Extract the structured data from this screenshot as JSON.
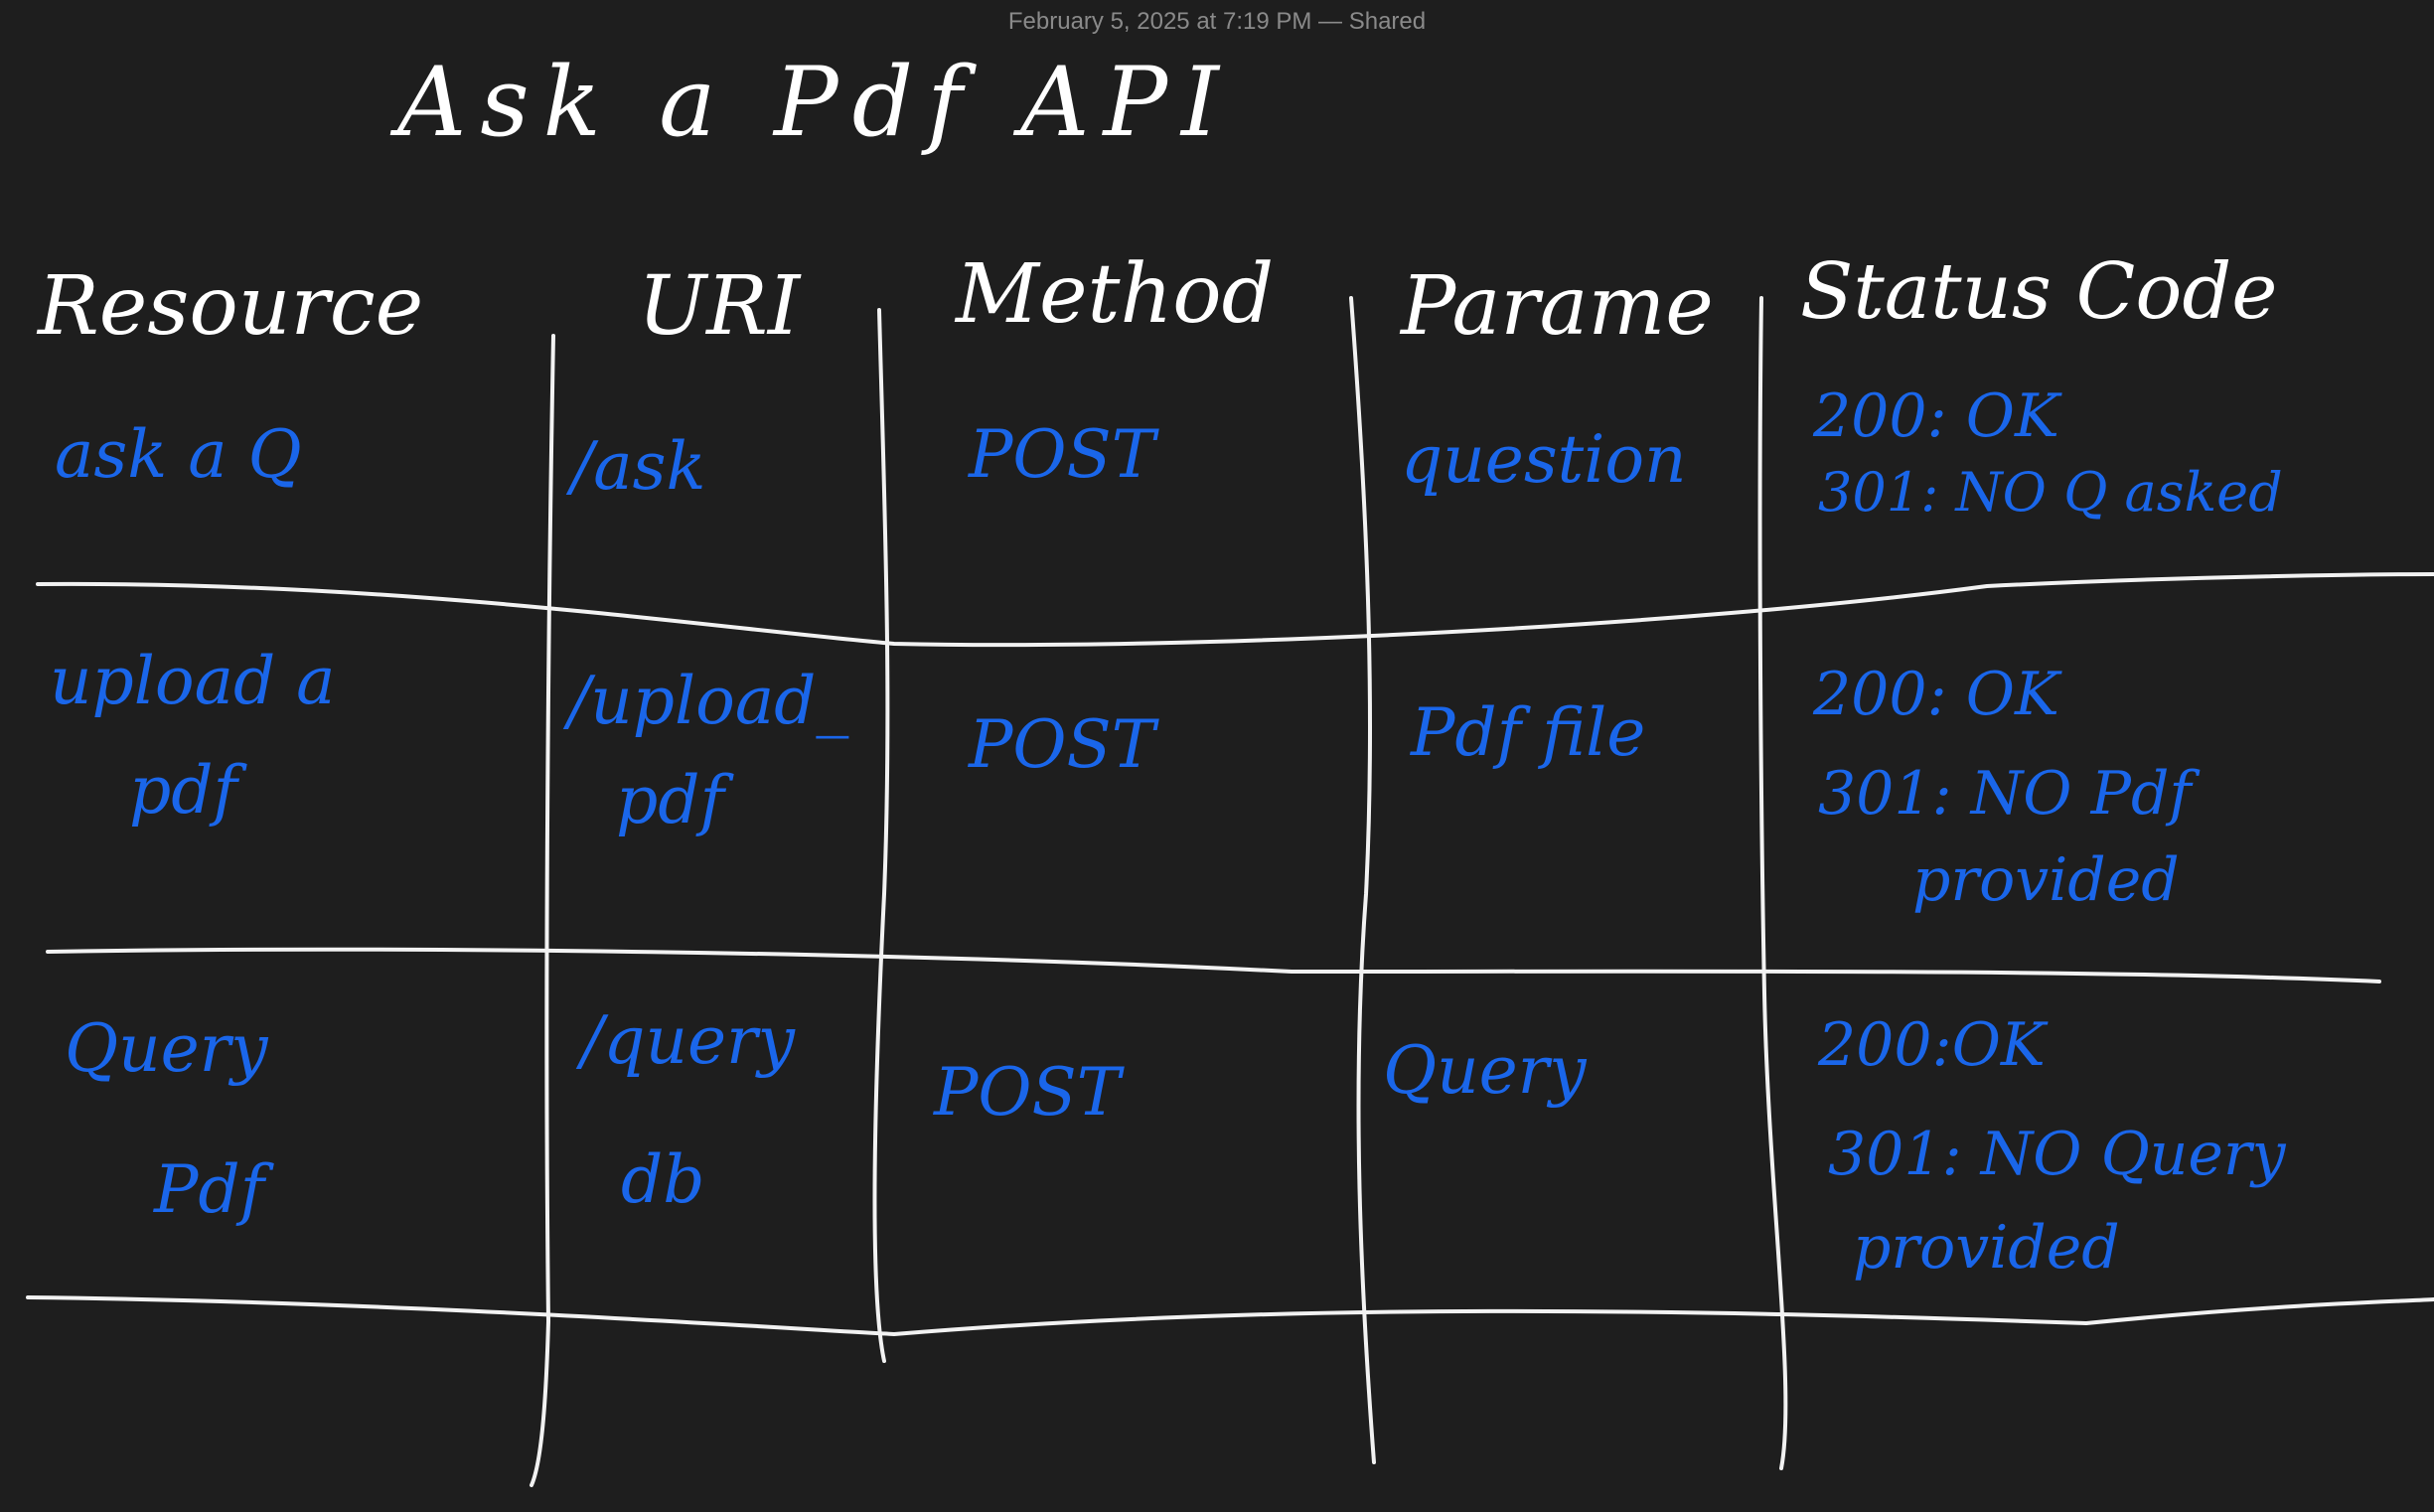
{
  "note": {
    "timestamp": "February 5, 2025 at 7:19 PM — Shared",
    "title": "Ask a Pdf API",
    "ink_colors": {
      "header": "#ffffff",
      "content": "#1a66ea",
      "background": "#1e1e1e"
    }
  },
  "table": {
    "headers": [
      "Resource",
      "URI",
      "Method",
      "Parame",
      "Status Code"
    ],
    "rows": [
      {
        "resource": [
          "ask a Q"
        ],
        "uri": [
          "/ask"
        ],
        "method": [
          "POST"
        ],
        "param": [
          "question"
        ],
        "status": [
          "200: OK",
          "301: NO Q asked"
        ]
      },
      {
        "resource": [
          "upload a",
          "pdf"
        ],
        "uri": [
          "/upload_",
          "pdf"
        ],
        "method": [
          "POST"
        ],
        "param": [
          "Pdf file"
        ],
        "status": [
          "200: OK",
          "301: NO Pdf",
          "provided"
        ]
      },
      {
        "resource": [
          "Query",
          "Pdf"
        ],
        "uri": [
          "/query",
          "db"
        ],
        "method": [
          "POST"
        ],
        "param": [
          "Query"
        ],
        "status": [
          "200:OK",
          "301: NO Query",
          "provided"
        ]
      }
    ]
  }
}
